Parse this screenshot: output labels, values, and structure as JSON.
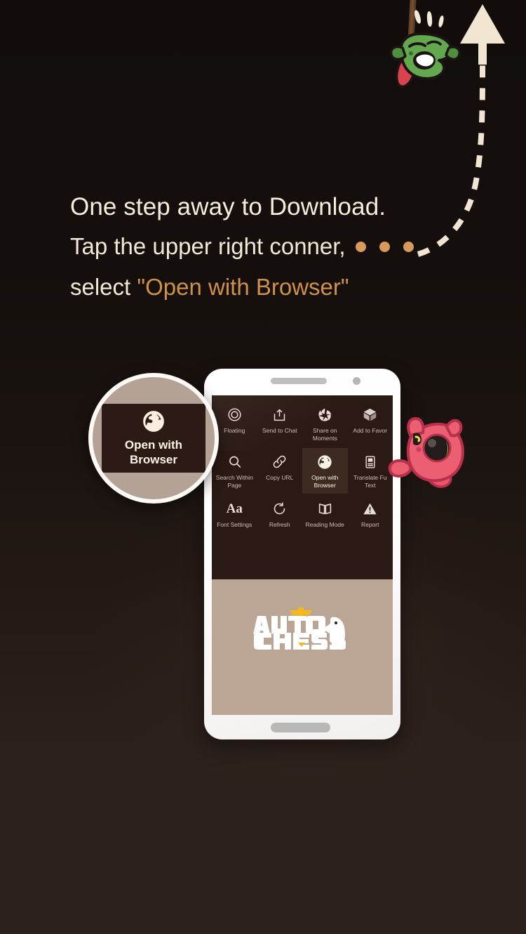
{
  "headline": {
    "line1": "One step away to Download.",
    "line2_prefix": "Tap the upper right conner,",
    "line3_prefix": "select ",
    "line3_accent": "\"Open with Browser\""
  },
  "colors": {
    "background_top": "#120d0b",
    "background_bottom": "#2b211c",
    "accent_orange": "#cf9149",
    "dot_orange": "#d89a5a",
    "text_cream": "#f2e8d8",
    "menu_panel": "#2b1a13",
    "menu_active_tile": "#3d2a20",
    "page_taupe": "#bba595",
    "magnifier_fill": "#b5a296",
    "goblin_green": "#5a9c46",
    "cat_pink": "#e8566a",
    "logo_yellow": "#f5b81a"
  },
  "dots": {
    "count": 3,
    "name": "more-options-dots"
  },
  "phone": {
    "menu": {
      "items": [
        {
          "label": "Floating",
          "icon": "floating-circle-icon",
          "active": false,
          "truncated": false
        },
        {
          "label": "Send to Chat",
          "icon": "share-export-icon",
          "active": false,
          "truncated": false
        },
        {
          "label": "Share on\nMoments",
          "icon": "camera-shutter-icon",
          "active": false,
          "truncated": false
        },
        {
          "label": "Add to Favor",
          "icon": "cube-icon",
          "active": false,
          "truncated": true
        },
        {
          "label": "Search Within\nPage",
          "icon": "search-icon",
          "active": false,
          "truncated": false
        },
        {
          "label": "Copy URL",
          "icon": "link-icon",
          "active": false,
          "truncated": false
        },
        {
          "label": "Open with\nBrowser",
          "icon": "globe-icon",
          "active": true,
          "truncated": false
        },
        {
          "label": "Translate Fu\nText",
          "icon": "document-translate-icon",
          "active": false,
          "truncated": false
        },
        {
          "label": "Font Settings",
          "icon": "font-size-aa-icon",
          "active": false,
          "truncated": false
        },
        {
          "label": "Refresh",
          "icon": "refresh-icon",
          "active": false,
          "truncated": false
        },
        {
          "label": "Reading Mode",
          "icon": "open-book-icon",
          "active": false,
          "truncated": false
        },
        {
          "label": "Report",
          "icon": "warning-triangle-icon",
          "active": false,
          "truncated": false
        }
      ]
    },
    "page_logo": {
      "line1": "AUTO",
      "line2": "CHESS",
      "name": "auto-chess-logo"
    }
  },
  "magnifier": {
    "label": "Open with\nBrowser",
    "icon": "globe-icon"
  },
  "mascots": {
    "goblin": "goblin-on-rope-mascot",
    "cat": "pink-cat-mascot"
  },
  "arrow": {
    "name": "dashed-curved-up-arrow"
  }
}
